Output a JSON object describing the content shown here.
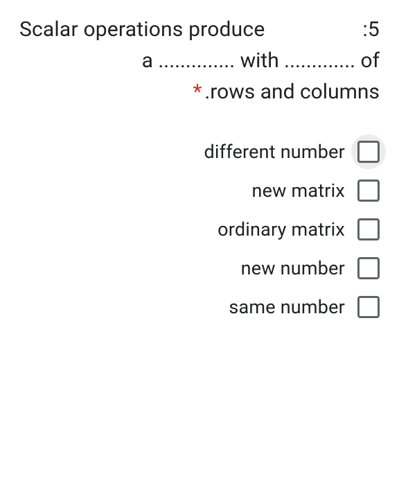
{
  "question": {
    "number": ":5",
    "line1_left": "Scalar operations produce",
    "line2": "a .............. with ............. of",
    "line3": ".rows and columns",
    "required_marker": "*"
  },
  "options": [
    {
      "label": "different number",
      "focused": true
    },
    {
      "label": "new matrix",
      "focused": false
    },
    {
      "label": "ordinary matrix",
      "focused": false
    },
    {
      "label": "new number",
      "focused": false
    },
    {
      "label": "same number",
      "focused": false
    }
  ]
}
